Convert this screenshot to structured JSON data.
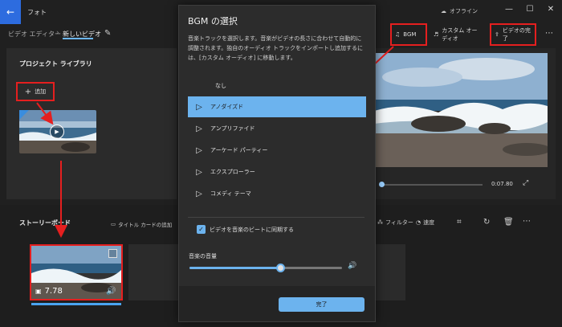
{
  "window": {
    "title": "フォト",
    "status": "オフライン",
    "controls": [
      "minimize-icon",
      "maximize-icon",
      "close-icon"
    ]
  },
  "toolbar": {
    "crumb_editor": "ビデオ エディター",
    "crumb_separator": "›",
    "crumb_current": "新しいビデオ",
    "bgm_label": "BGM",
    "custom_audio_label": "カスタム オーディオ",
    "finish_video_label": "ビデオの完了"
  },
  "library": {
    "title": "プロジェクト ライブラリ",
    "add_label": "追加"
  },
  "preview": {
    "time": "0:07.80"
  },
  "storyboard": {
    "title": "ストーリーボード",
    "title_card_label": "タイトル カードの追加",
    "filter_label": "フィルター",
    "speed_label": "速度",
    "clip_duration": "7.78"
  },
  "dialog": {
    "title": "BGM の選択",
    "description": "音楽トラックを選択します。音楽がビデオの長さに合わせて自動的に調整されます。独自のオーディオ トラックをインポートし追加するには、[カスタム オーディオ] に移動します。",
    "tracks": [
      "なし",
      "アノダイズド",
      "アンプリファイド",
      "アーケード パーティー",
      "エクスプローラー",
      "コメディ テーマ"
    ],
    "selected_index": 1,
    "sync_label": "ビデオを音楽のビートに同期する",
    "sync_checked": true,
    "volume_label": "音楽の音量",
    "volume_level": 0.6,
    "done_label": "完了"
  },
  "colors": {
    "accent": "#6cb3ee",
    "highlight_box": "#e51f1f",
    "background": "#202020"
  }
}
